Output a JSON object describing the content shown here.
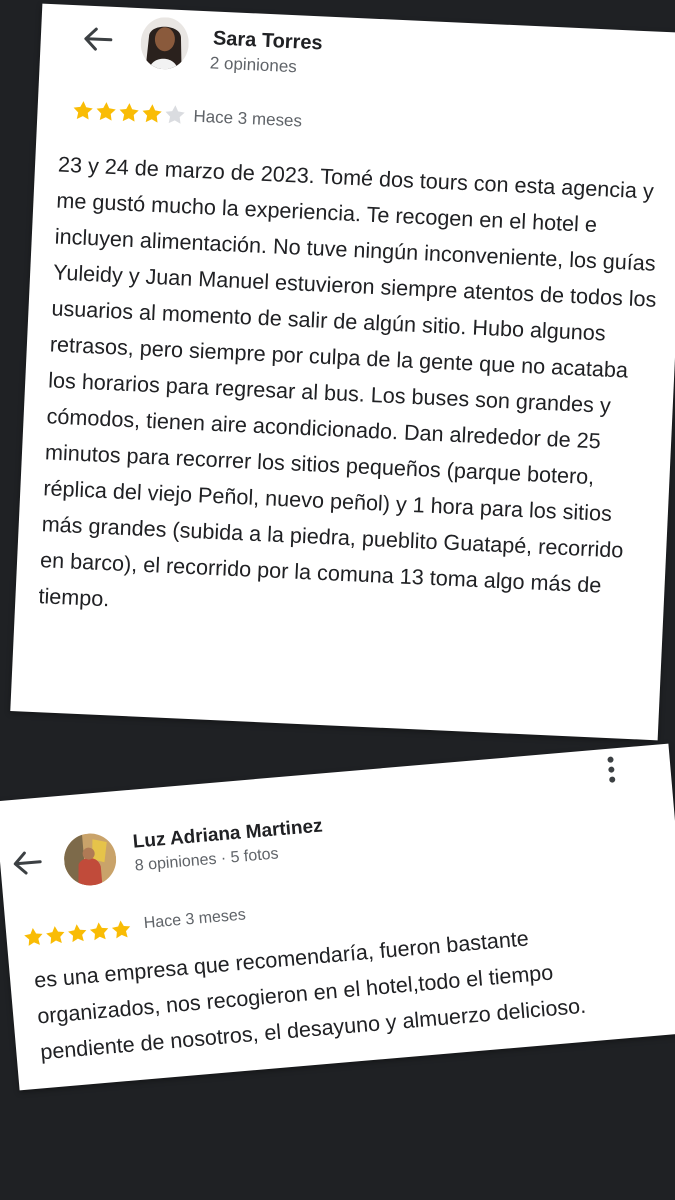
{
  "reviews": [
    {
      "author": "Sara Torres",
      "author_meta": "2 opiniones",
      "rating": 4,
      "rating_max": 5,
      "time_ago": "Hace 3 meses",
      "text": "23 y 24 de marzo de 2023. Tomé dos tours con esta agencia y me gustó mucho la experiencia. Te recogen en el hotel e incluyen alimentación. No tuve ningún inconveniente, los guías Yuleidy y Juan Manuel estuvieron siempre atentos de todos los usuarios al momento de salir de algún sitio. Hubo algunos retrasos, pero siempre por culpa de la gente que no acataba los horarios para regresar al bus. Los buses son grandes y cómodos, tienen aire acondicionado. Dan alrededor de 25 minutos para recorrer los sitios pequeños (parque botero, réplica del viejo Peñol, nuevo peñol) y 1 hora para los sitios más grandes (subida a la piedra, pueblito Guatapé, recorrido en barco), el recorrido por la comuna 13 toma algo más de tiempo."
    },
    {
      "author": "Luz Adriana Martinez",
      "author_meta": "8 opiniones · 5 fotos",
      "rating": 5,
      "rating_max": 5,
      "time_ago": "Hace 3 meses",
      "text": "es una empresa que recomendaría, fueron bastante organizados, nos recogieron en el hotel,todo el tiempo pendiente de nosotros, el desayuno y almuerzo delicioso."
    }
  ],
  "icons": {
    "back": "arrow-left-icon",
    "more": "more-vert-icon",
    "star": "star-icon"
  },
  "colors": {
    "star_filled": "#f9bc05",
    "star_empty": "#dadce0",
    "background": "#1f2124"
  }
}
